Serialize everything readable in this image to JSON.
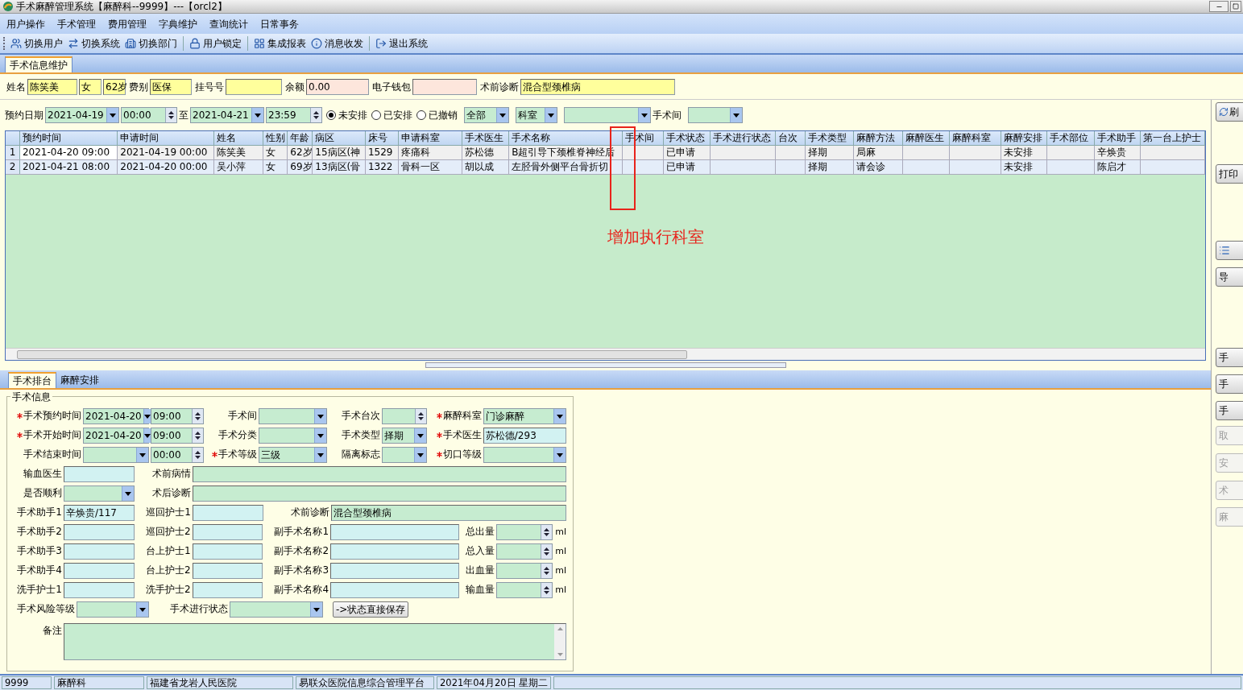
{
  "window": {
    "title": "手术麻醉管理系统【麻醉科--9999】---【orcl2】"
  },
  "menu": [
    "用户操作",
    "手术管理",
    "费用管理",
    "字典维护",
    "查询统计",
    "日常事务"
  ],
  "toolbar": [
    [
      "切换用户",
      "切换系统",
      "切换部门"
    ],
    [
      "用户锁定"
    ],
    [
      "集成报表",
      "消息收发"
    ],
    [
      "退出系统"
    ]
  ],
  "page_tabs": [
    {
      "label": "手术信息维护",
      "selected": true
    }
  ],
  "patient": [
    {
      "kind": "label",
      "text": "姓名"
    },
    {
      "kind": "field",
      "value": "陈笑美"
    },
    {
      "kind": "field",
      "value": "女"
    },
    {
      "kind": "field",
      "value": "62岁"
    },
    {
      "kind": "label",
      "text": "费别"
    },
    {
      "kind": "field",
      "value": "医保"
    },
    {
      "kind": "label",
      "text": "挂号号"
    },
    {
      "kind": "field"
    },
    {
      "kind": "label",
      "text": "余额"
    },
    {
      "kind": "money",
      "value": "0.00"
    },
    {
      "kind": "label",
      "text": "电子钱包"
    },
    {
      "kind": "money"
    },
    {
      "kind": "label",
      "text": "术前诊断"
    },
    {
      "kind": "field",
      "value": "混合型颈椎病"
    }
  ],
  "filter": [
    {
      "kind": "label",
      "text": "预约日期"
    },
    {
      "kind": "date",
      "value": "2021-04-19"
    },
    {
      "kind": "time",
      "value": "00:00"
    },
    {
      "kind": "label",
      "text": "至"
    },
    {
      "kind": "date",
      "value": "2021-04-21"
    },
    {
      "kind": "time",
      "value": "23:59"
    },
    {
      "kind": "radio",
      "text": "未安排",
      "selected": true
    },
    {
      "kind": "radio",
      "text": "已安排",
      "selected": false
    },
    {
      "kind": "radio",
      "text": "已撤销",
      "selected": false
    },
    {
      "kind": "combo",
      "value": "全部"
    },
    {
      "kind": "combo",
      "value": "科室"
    },
    {
      "kind": "combo"
    },
    {
      "kind": "label",
      "text": "手术间"
    },
    {
      "kind": "combo"
    }
  ],
  "table": {
    "columns": [
      "预约时间",
      "申请时间",
      "姓名",
      "性别",
      "年龄",
      "病区",
      "床号",
      "申请科室",
      "手术医生",
      "手术名称",
      "手术间",
      "手术状态",
      "手术进行状态",
      "台次",
      "手术类型",
      "麻醉方法",
      "麻醉医生",
      "麻醉科室",
      "麻醉安排",
      "手术部位",
      "手术助手",
      "第一台上护士"
    ],
    "rows": [
      {
        "number": "1",
        "selected": true,
        "cells": [
          "2021-04-20 09:00",
          "2021-04-19 00:00",
          "陈笑美",
          "女",
          "62岁",
          "15病区(神",
          "1529",
          "疼痛科",
          "苏松德",
          "B超引导下颈椎脊神经后",
          null,
          "已申请",
          null,
          null,
          "择期",
          "局麻",
          null,
          null,
          "未安排",
          null,
          "辛焕贵",
          null
        ]
      },
      {
        "number": "2",
        "selected": false,
        "cells": [
          "2021-04-21 08:00",
          "2021-04-20 00:00",
          "吴小萍",
          "女",
          "69岁",
          "13病区(骨",
          "1322",
          "骨科一区",
          "胡以成",
          "左胫骨外侧平台骨折切",
          null,
          "已申请",
          null,
          null,
          "择期",
          "请会诊",
          null,
          null,
          "未安排",
          null,
          "陈启才",
          null
        ]
      }
    ]
  },
  "annotation": {
    "text": "增加执行科室"
  },
  "lower_tabs": [
    {
      "label": "手术排台",
      "selected": true
    },
    {
      "label": "麻醉安排",
      "selected": false
    }
  ],
  "form": {
    "legend": "手术信息",
    "rows": [
      {
        "kind": "four",
        "items": [
          {
            "label": "手术预约时间",
            "required": true,
            "kind": "datetime",
            "date": "2021-04-20",
            "time": "09:00"
          },
          {
            "label": "手术间",
            "required": false,
            "kind": "combo"
          },
          {
            "label": "手术台次",
            "required": false,
            "kind": "spin"
          },
          {
            "label": "麻醉科室",
            "required": true,
            "kind": "combo",
            "value": "门诊麻醉"
          }
        ]
      },
      {
        "kind": "four",
        "items": [
          {
            "label": "手术开始时间",
            "required": true,
            "kind": "datetime",
            "date": "2021-04-20",
            "time": "09:00"
          },
          {
            "label": "手术分类",
            "required": false,
            "kind": "combo"
          },
          {
            "label": "手术类型",
            "required": false,
            "kind": "combo",
            "value": "择期"
          },
          {
            "label": "手术医生",
            "required": true,
            "kind": "text",
            "value": "苏松德/293"
          }
        ]
      },
      {
        "kind": "four",
        "items": [
          {
            "label": "手术结束时间",
            "required": false,
            "kind": "datetime",
            "time": "00:00"
          },
          {
            "label": "手术等级",
            "required": true,
            "kind": "combo",
            "value": "三级"
          },
          {
            "label": "隔离标志",
            "required": false,
            "kind": "combo"
          },
          {
            "label": "切口等级",
            "required": true,
            "kind": "combo"
          }
        ]
      },
      {
        "kind": "two",
        "items": [
          {
            "label": "输血医生",
            "kind": "text"
          },
          {
            "label": "术前病情",
            "kind": "wide"
          }
        ]
      },
      {
        "kind": "two",
        "items": [
          {
            "label": "是否顺利",
            "kind": "combo"
          },
          {
            "label": "术后诊断",
            "kind": "wide"
          }
        ]
      },
      {
        "kind": "people",
        "items": [
          {
            "label": "手术助手1",
            "kind": "text",
            "value": "辛焕贵/117"
          },
          {
            "label": "巡回护士1",
            "kind": "text"
          },
          {
            "label": "术前诊断",
            "kind": "wide",
            "value": "混合型颈椎病"
          }
        ]
      },
      {
        "kind": "people",
        "items": [
          {
            "label": "手术助手2",
            "kind": "text"
          },
          {
            "label": "巡回护士2",
            "kind": "text"
          },
          {
            "label": "副手术名称1",
            "kind": "text"
          },
          {
            "label": "总出量",
            "kind": "spin",
            "unit": "ml"
          }
        ]
      },
      {
        "kind": "people",
        "items": [
          {
            "label": "手术助手3",
            "kind": "text"
          },
          {
            "label": "台上护士1",
            "kind": "text"
          },
          {
            "label": "副手术名称2",
            "kind": "text"
          },
          {
            "label": "总入量",
            "kind": "spin",
            "unit": "ml"
          }
        ]
      },
      {
        "kind": "people",
        "items": [
          {
            "label": "手术助手4",
            "kind": "text"
          },
          {
            "label": "台上护士2",
            "kind": "text"
          },
          {
            "label": "副手术名称3",
            "kind": "text"
          },
          {
            "label": "出血量",
            "kind": "spin",
            "unit": "ml"
          }
        ]
      },
      {
        "kind": "people",
        "items": [
          {
            "label": "洗手护士1",
            "kind": "text"
          },
          {
            "label": "洗手护士2",
            "kind": "text"
          },
          {
            "label": "副手术名称4",
            "kind": "text"
          },
          {
            "label": "输血量",
            "kind": "spin",
            "unit": "ml"
          }
        ]
      },
      {
        "kind": "actions",
        "items": [
          {
            "label": "手术风险等级",
            "kind": "combo"
          },
          {
            "label": "手术进行状态",
            "kind": "combo"
          },
          {
            "kind": "button",
            "text": "->状态直接保存"
          }
        ]
      },
      {
        "kind": "memo",
        "items": [
          {
            "label": "备注",
            "kind": "memo"
          }
        ]
      }
    ]
  },
  "side_buttons": [
    {
      "kind": "refresh",
      "label": "刷",
      "disabled": false
    },
    {
      "kind": "text",
      "label": "打印",
      "disabled": false
    },
    {
      "kind": "icon",
      "disabled": false
    },
    {
      "kind": "text",
      "label": "导",
      "disabled": false
    },
    {
      "kind": "text",
      "label": "手",
      "disabled": false
    },
    {
      "kind": "text",
      "label": "手",
      "disabled": false
    },
    {
      "kind": "text",
      "label": "手",
      "disabled": false
    },
    {
      "kind": "text",
      "label": "取",
      "disabled": true
    },
    {
      "kind": "text",
      "label": "安",
      "disabled": true
    },
    {
      "kind": "text",
      "label": "术",
      "disabled": true
    },
    {
      "kind": "text",
      "label": "麻",
      "disabled": true
    }
  ],
  "status_bar": [
    "9999",
    "麻醉科",
    "福建省龙岩人民医院",
    "易联众医院信息综合管理平台",
    "2021年04月20日  星期二"
  ]
}
